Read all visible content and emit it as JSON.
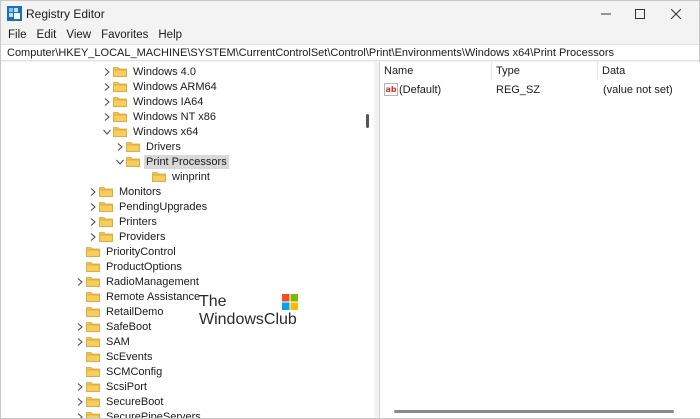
{
  "window": {
    "title": "Registry Editor",
    "icon": "registry-editor-icon",
    "controls": [
      "minimize-icon",
      "maximize-icon",
      "close-icon"
    ]
  },
  "menu": [
    "File",
    "Edit",
    "View",
    "Favorites",
    "Help"
  ],
  "address": "Computer\\HKEY_LOCAL_MACHINE\\SYSTEM\\CurrentControlSet\\Control\\Print\\Environments\\Windows x64\\Print Processors",
  "tree": [
    {
      "label": "Windows 4.0",
      "expander": "chevron-right"
    },
    {
      "label": "Windows ARM64",
      "expander": "chevron-right"
    },
    {
      "label": "Windows IA64",
      "expander": "chevron-right"
    },
    {
      "label": "Windows NT x86",
      "expander": "chevron-right"
    },
    {
      "label": "Windows x64",
      "expander": "chevron-down"
    },
    {
      "label": "Drivers",
      "expander": "chevron-right"
    },
    {
      "label": "Print Processors",
      "expander": "chevron-down",
      "selected": true
    },
    {
      "label": "winprint",
      "expander": "none"
    },
    {
      "label": "Monitors",
      "expander": "chevron-right"
    },
    {
      "label": "PendingUpgrades",
      "expander": "chevron-right"
    },
    {
      "label": "Printers",
      "expander": "chevron-right"
    },
    {
      "label": "Providers",
      "expander": "chevron-right"
    },
    {
      "label": "PriorityControl",
      "expander": "none"
    },
    {
      "label": "ProductOptions",
      "expander": "none"
    },
    {
      "label": "RadioManagement",
      "expander": "chevron-right"
    },
    {
      "label": "Remote Assistance",
      "expander": "none"
    },
    {
      "label": "RetailDemo",
      "expander": "none"
    },
    {
      "label": "SafeBoot",
      "expander": "chevron-right"
    },
    {
      "label": "SAM",
      "expander": "chevron-right"
    },
    {
      "label": "ScEvents",
      "expander": "none"
    },
    {
      "label": "SCMConfig",
      "expander": "none"
    },
    {
      "label": "ScsiPort",
      "expander": "chevron-right"
    },
    {
      "label": "SecureBoot",
      "expander": "chevron-right"
    },
    {
      "label": "SecurePipeServers",
      "expander": "chevron-right"
    }
  ],
  "list": {
    "columns": [
      "Name",
      "Type",
      "Data"
    ],
    "rows": [
      {
        "name": "(Default)",
        "type": "REG_SZ",
        "data": "(value not set)",
        "icon": "string-value-icon"
      }
    ]
  },
  "watermark": {
    "line1": "The",
    "line2": "WindowsClub",
    "logo": "windows-logo-icon"
  },
  "colors": {
    "folder": "#f2c14e",
    "selection": "#d9d9d9",
    "titlebar": "#f3f3f3"
  }
}
